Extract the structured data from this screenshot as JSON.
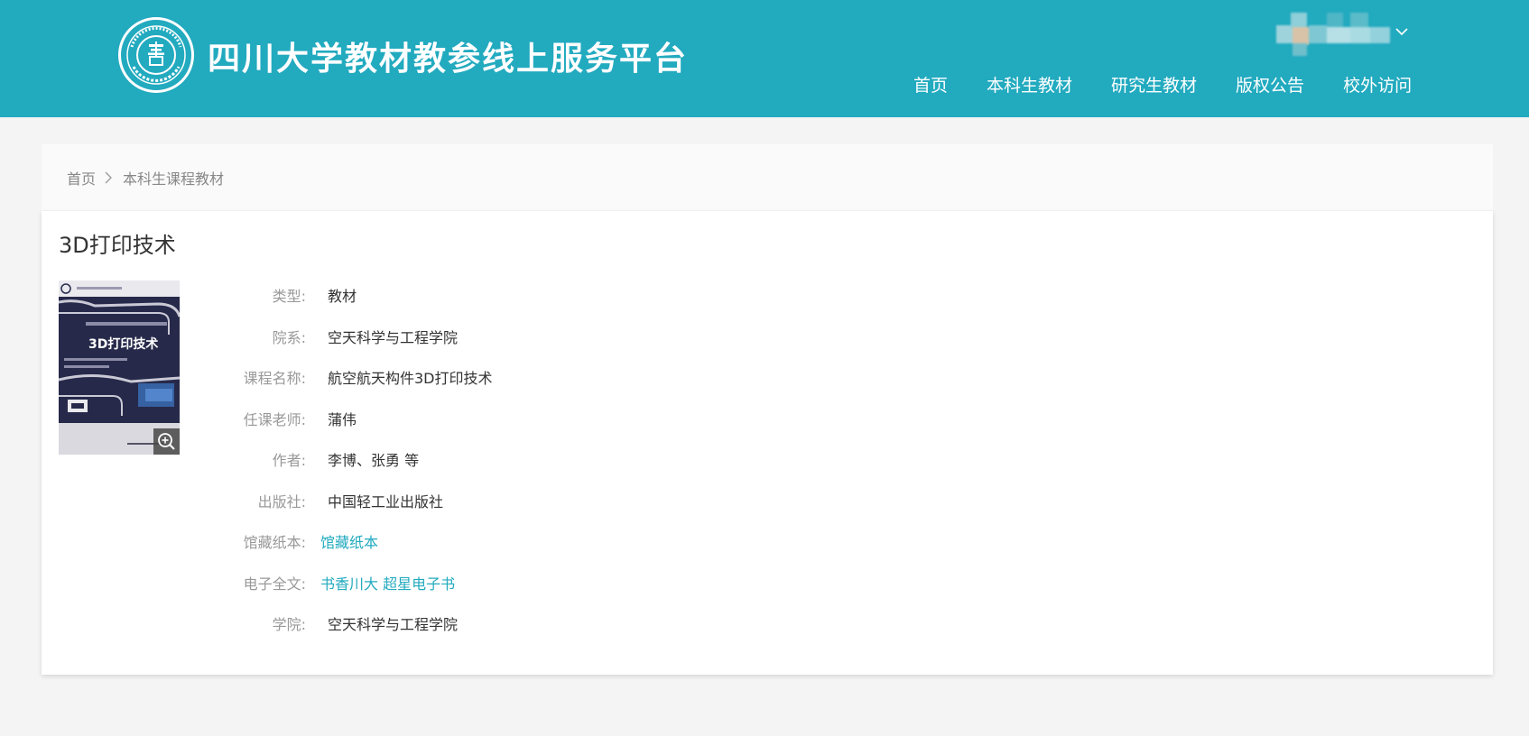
{
  "header": {
    "site_title": "四川大学教材教参线上服务平台",
    "logo_icon": "sichuan-university-library-seal",
    "background_color": "#22aabf",
    "nav": [
      {
        "label": "首页"
      },
      {
        "label": "本科生教材"
      },
      {
        "label": "研究生教材"
      },
      {
        "label": "版权公告"
      },
      {
        "label": "校外访问"
      }
    ],
    "user_icon": "blurred-user-avatar",
    "dropdown_icon": "chevron-down-icon"
  },
  "breadcrumb": {
    "home": "首页",
    "separator_icon": "chevron-right-icon",
    "current": "本科生课程教材"
  },
  "book": {
    "title": "3D打印技术",
    "cover_icon": "book-cover-image",
    "zoom_icon": "zoom-in-icon",
    "fields": [
      {
        "label": "类型:",
        "value": "教材"
      },
      {
        "label": "院系:",
        "value": "空天科学与工程学院"
      },
      {
        "label": "课程名称:",
        "value": "航空航天构件3D打印技术"
      },
      {
        "label": "任课老师:",
        "value": "蒲伟"
      },
      {
        "label": "作者:",
        "value": "李博、张勇 等"
      },
      {
        "label": "出版社:",
        "value": "中国轻工业出版社"
      }
    ],
    "print_copy": {
      "label": "馆藏纸本:",
      "link": "馆藏纸本"
    },
    "ebook": {
      "label": "电子全文:",
      "links": [
        "书香川大",
        "超星电子书"
      ]
    },
    "college": {
      "label": "学院:",
      "value": "空天科学与工程学院"
    },
    "link_color": "#22aabf"
  }
}
